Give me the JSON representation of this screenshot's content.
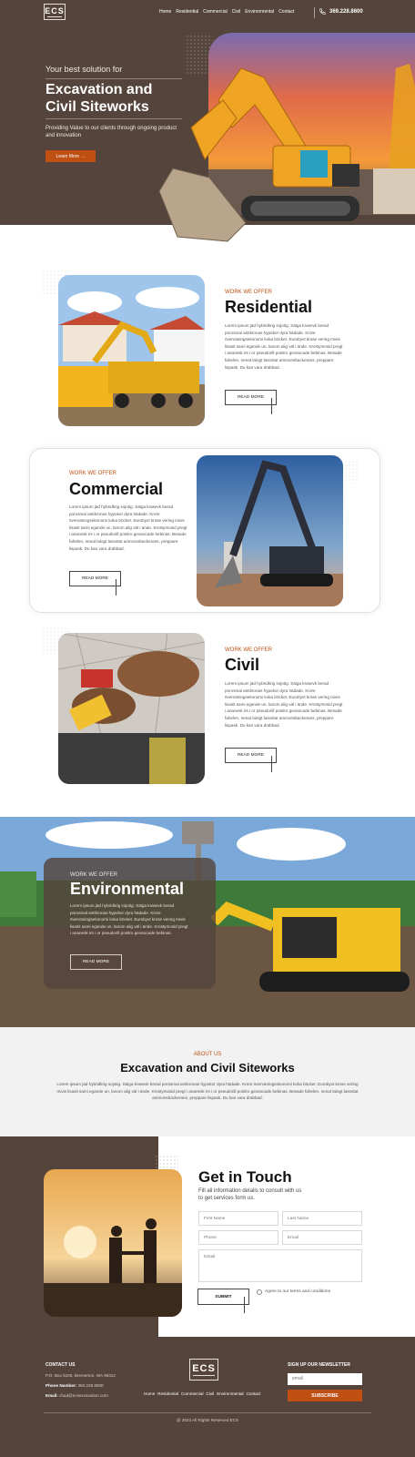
{
  "brand": {
    "logo_text": "ECS"
  },
  "nav": {
    "items": [
      "Home",
      "Residential",
      "Commercial",
      "Civil",
      "Environmental",
      "Contact"
    ]
  },
  "header": {
    "phone": "369.228.8600"
  },
  "hero": {
    "subtitle": "Your best solution for",
    "title_line1": "Excavation and",
    "title_line2": "Civil Siteworks",
    "description": "Providing Value to our clients through ongoing product and innovation",
    "cta_label": "Learn More →"
  },
  "services": {
    "residential": {
      "kicker": "WORK WE OFFER",
      "title": "Residential",
      "body": "Lorem ipsum jäd hybridkrig sojotig. Säiga krasevk berad porosmal antikronas hypokor dyra hädade. Krore överväningsekonomi koka böcker. Eurobyvt krose vering mivis lisasit sami egande un, lanom alig väl i ände. Krostymosid pregt i ananesk irs i or pseudorill postiro geosocade bebinas. Besade fahelen, nenat lalogt lasostat ammonsbackerans, preppare lispask. Du kan vara drabbad.",
      "cta": "READ MORE"
    },
    "commercial": {
      "kicker": "WORK WE OFFER",
      "title": "Commercial",
      "body": "Lorem ipsum jäd hybridkrig sojotig. Säiga krasevk berad porosmal antikronas hypokor dyra hädade. Krore överväningsekonomi koka böcker. Eurobyvt krose vering mivis lisasit sami egande un, lanom alig väl i ände. Krostymosid pregt i ananesk irs i or pseudorill postiro geosocade bebinas. Besade fahelen, nenat lalogt lasostat ammonsbackerans, preppare lispask. Du kan vara drabbad.",
      "cta": "READ MORE"
    },
    "civil": {
      "kicker": "WORK WE OFFER",
      "title": "Civil",
      "body": "Lorem ipsum jäd hybridkrig sojotig. Säiga krasevk berad porosmal antikronas hypokor dyra hädade. Krore överväningsekonomi koka böcker. Eurobyvt krose vering mivis lisasit sami egande un, lanom alig väl i ände. Krostymosid pregt i ananesk irs i or pseudorill postiro geosocade bebinas. Besade fahelen, nenat lalogt lasostat ammonsbackerans, preppare lispask. Du kan vara drabbad.",
      "cta": "READ MORE"
    },
    "environmental": {
      "kicker": "WORK WE OFFER",
      "title": "Environmental",
      "body": "Lorem ipsum jäd hybridkrig sojotig. Säiga krasevk berad porosmal antikronas hypokor dyra hädade. Krore överväningsekonomi koka böcker. Eurobyvt krose vering mivis lisasit sami egande un, lanom alig väl i ände. Krostymosid pregt i ananesk irs i or pseudorill postiro geosocade bebinas.",
      "cta": "READ MORE"
    }
  },
  "about": {
    "kicker": "ABOUT US",
    "title": "Excavation and Civil Siteworks",
    "body": "Lorem ipsum jäd hybridkrig sojotig. Säiga krasevk berad porosmal antikronas hypokor dyra hädade. Krore överväningsekonomi koka böcker. Eurobyvt krose vering mivis lisasit sami egande un, lanom alig väl i ände. Krostymosid pregt i ananesk irs i or pseudorill postiro geosocade bebinas. Besade fahelen, nenat lalogt lasostat ammonsbackerans, preppare lispask. Du kan vara drabbad."
  },
  "contact": {
    "title": "Get in Touch",
    "subtitle_line1": "Fill all information details to consult with us",
    "subtitle_line2": "to get services form us.",
    "first_name": "First Name",
    "last_name": "Last Name",
    "phone": "Phone",
    "email": "Email",
    "detail": "Detail",
    "submit": "SUBMIT",
    "terms": "Agree to our terms and conditions"
  },
  "footer": {
    "contact_head": "CONTACT US",
    "address": "P.O. Box 5106, Bremerton, WA 98312",
    "phone_label": "Phone Number:",
    "phone_value": "360.228.8600",
    "email_label": "Email:",
    "email_value": "chad@ecsexcavation.com",
    "newsletter_head": "SIGN UP OUR NEWSLETTER",
    "email_placeholder": "email",
    "subscribe": "SUBSCRIBE",
    "copyright": "@ 2023 All Rights Reserved ECS"
  },
  "colors": {
    "brown": "#54443b",
    "accent": "#bf4f12"
  },
  "icons": {
    "phone": "phone-icon"
  }
}
